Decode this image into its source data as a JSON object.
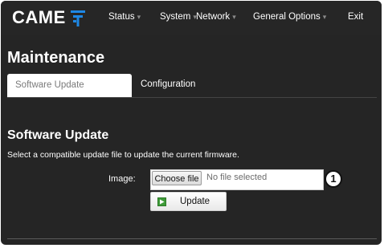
{
  "brand": {
    "logo_text": "CAME",
    "logo_icon": "came-antenna-logo-icon",
    "accent": "#1e88e5"
  },
  "nav": {
    "items": [
      {
        "label": "Status",
        "has_dropdown": true
      },
      {
        "label": "System",
        "has_dropdown": true
      },
      {
        "label": "Network",
        "has_dropdown": true
      },
      {
        "label": "General Options",
        "has_dropdown": true
      },
      {
        "label": "Exit",
        "has_dropdown": false
      }
    ],
    "caret": "▾"
  },
  "page": {
    "title": "Maintenance"
  },
  "tabs": [
    {
      "label": "Software Update",
      "active": true
    },
    {
      "label": "Configuration",
      "active": false
    }
  ],
  "section": {
    "title": "Software Update",
    "description": "Select a compatible update file to update the current firmware.",
    "image_label": "Image:",
    "file_input": {
      "button_label": "Choose file",
      "status": "No file selected"
    },
    "callout": "1",
    "update_button": {
      "label": "Update",
      "icon": "play-green-icon"
    }
  }
}
